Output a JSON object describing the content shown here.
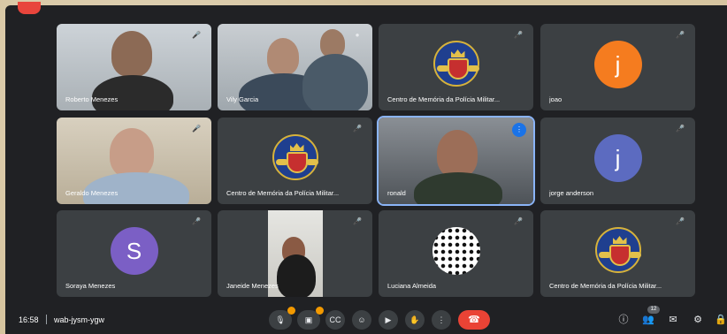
{
  "participants": [
    {
      "name": "Roberto Menezes"
    },
    {
      "name": "Vily Garcia"
    },
    {
      "name": "Centro de Memória da Polícia Militar..."
    },
    {
      "name": "joao",
      "initial": "j",
      "color": "#f57c1f"
    },
    {
      "name": "Geraldo Menezes"
    },
    {
      "name": "Centro de Memória da Polícia Militar..."
    },
    {
      "name": "ronald"
    },
    {
      "name": "jorge anderson",
      "initial": "j",
      "color": "#5c6bc0"
    },
    {
      "name": "Soraya Menezes",
      "initial": "S",
      "color": "#7b5fc5"
    },
    {
      "name": "Janeide Menezes"
    },
    {
      "name": "Luciana Almeida"
    },
    {
      "name": "Centro de Memória da Polícia Militar..."
    }
  ],
  "bottom_bar": {
    "time": "16:58",
    "meeting_code": "wab-jysm-ygw",
    "people_count": "12"
  },
  "icons": {
    "mic_muted": "mic-off-icon",
    "camera": "camera-icon",
    "captions": "captions-icon",
    "emoji": "emoji-icon",
    "present": "present-icon",
    "raise_hand": "hand-icon",
    "more": "more-icon",
    "hangup": "hangup-icon",
    "info": "info-icon",
    "people": "people-icon",
    "chat": "chat-icon",
    "activities": "activities-icon"
  },
  "colors": {
    "accent": "#8ab4f8",
    "hangup": "#ea4335",
    "badge": "#f29900"
  }
}
